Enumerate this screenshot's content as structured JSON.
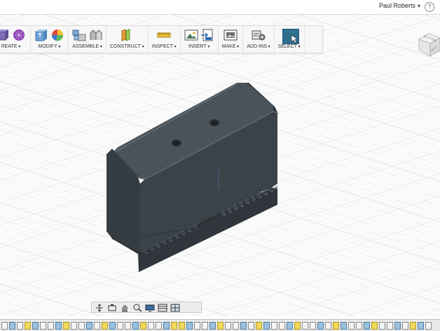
{
  "header": {
    "user_name": "Paul Roberts",
    "help_icon": "?"
  },
  "toolbar": {
    "groups": [
      {
        "label": "REATE",
        "icons": [
          "box-icon",
          "pattern-grid-icon"
        ]
      },
      {
        "label": "MODIFY",
        "icons": [
          "press-pull-icon",
          "appearance-icon"
        ]
      },
      {
        "label": "ASSEMBLE",
        "icons": [
          "new-component-icon",
          "joint-icon"
        ]
      },
      {
        "label": "CONSTRUCT",
        "icons": [
          "offset-plane-icon"
        ]
      },
      {
        "label": "INSPECT",
        "icons": [
          "measure-icon"
        ]
      },
      {
        "label": "INSERT",
        "icons": [
          "insert-image-icon",
          "insert-mesh-icon"
        ]
      },
      {
        "label": "MAKE",
        "icons": [
          "3d-print-icon"
        ]
      },
      {
        "label": "ADD-INS",
        "icons": [
          "scripts-icon"
        ]
      },
      {
        "label": "SELECT",
        "icons": [
          "select-arrow-icon"
        ]
      }
    ],
    "accent_color": "#2f6f8f"
  },
  "viewcube": {
    "face_top": "BOTTOM",
    "face_side": "LEFT"
  },
  "navigation_bar": {
    "icons": [
      "orbit-icon",
      "look-at-icon",
      "pan-icon",
      "zoom-icon",
      "display-settings-icon",
      "grid-settings-icon",
      "viewports-icon"
    ]
  },
  "model": {
    "body_color": "#3d454c",
    "holes": 2,
    "rack_teeth": 9
  },
  "timeline": {
    "item_count": 56
  }
}
